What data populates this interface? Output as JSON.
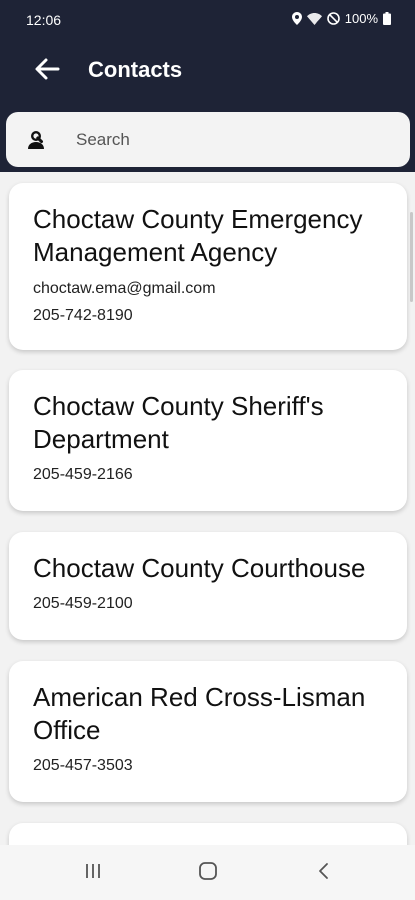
{
  "status_bar": {
    "time": "12:06",
    "battery": "100%",
    "icons": [
      "location-icon",
      "wifi-icon",
      "do-not-disturb-icon",
      "battery-icon"
    ]
  },
  "app_bar": {
    "title": "Contacts",
    "back_icon": "arrow-left-icon"
  },
  "search": {
    "placeholder": "Search",
    "value": "",
    "icon": "person-search-icon"
  },
  "contacts": [
    {
      "name": "Choctaw County Emergency Management Agency",
      "email": "choctaw.ema@gmail.com",
      "phone": "205-742-8190"
    },
    {
      "name": "Choctaw County Sheriff's Department",
      "phone": "205-459-2166"
    },
    {
      "name": "Choctaw County Courthouse",
      "phone": "205-459-2100"
    },
    {
      "name": "American Red Cross-Lisman Office",
      "phone": "205-457-3503"
    }
  ],
  "nav_bar": {
    "icons": [
      "recent-apps-icon",
      "home-icon",
      "back-icon"
    ]
  },
  "colors": {
    "header_bg": "#1e2336",
    "page_bg": "#f2f2f2",
    "card_bg": "#ffffff"
  }
}
